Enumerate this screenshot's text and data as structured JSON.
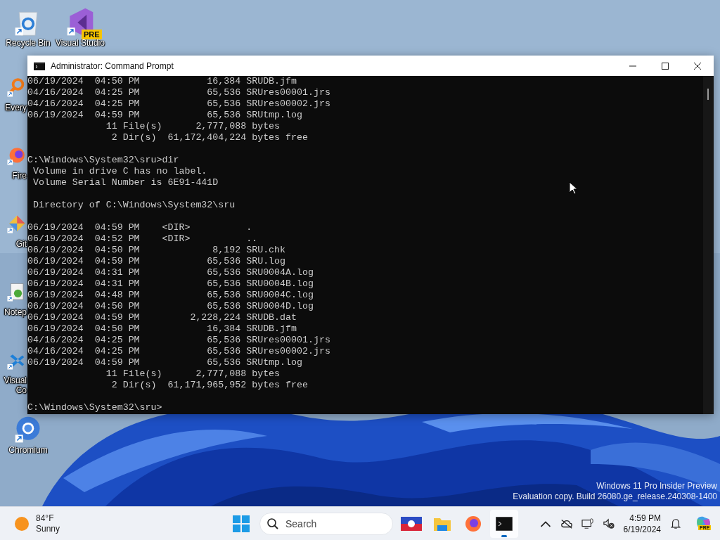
{
  "desktop_icons": [
    {
      "kind": "recycle",
      "lines": [
        "Recycle Bin"
      ]
    },
    {
      "kind": "vs",
      "lines": [
        "Visual Studio"
      ],
      "badge": "PRE"
    },
    {
      "kind": "everything",
      "lines": [
        "Every"
      ]
    },
    {
      "kind": "firefox",
      "lines": [
        "Fire"
      ]
    },
    {
      "kind": "git",
      "lines": [
        "Git"
      ]
    },
    {
      "kind": "notepad",
      "lines": [
        "Notep"
      ]
    },
    {
      "kind": "vscode",
      "lines": [
        "Visual",
        "Co"
      ]
    },
    {
      "kind": "chromium",
      "lines": [
        "Chromium"
      ]
    }
  ],
  "window": {
    "title": "Administrator: Command Prompt",
    "console_blocks": [
      [
        "06/19/2024  04:50 PM            16,384 SRUDB.jfm",
        "04/16/2024  04:25 PM            65,536 SRUres00001.jrs",
        "04/16/2024  04:25 PM            65,536 SRUres00002.jrs",
        "06/19/2024  04:59 PM            65,536 SRUtmp.log",
        "              11 File(s)      2,777,088 bytes",
        "               2 Dir(s)  61,172,404,224 bytes free"
      ],
      [
        "C:\\Windows\\System32\\sru>dir",
        " Volume in drive C has no label.",
        " Volume Serial Number is 6E91-441D"
      ],
      [
        " Directory of C:\\Windows\\System32\\sru"
      ],
      [
        "06/19/2024  04:59 PM    <DIR>          .",
        "06/19/2024  04:52 PM    <DIR>          ..",
        "06/19/2024  04:50 PM             8,192 SRU.chk",
        "06/19/2024  04:59 PM            65,536 SRU.log",
        "06/19/2024  04:31 PM            65,536 SRU0004A.log",
        "06/19/2024  04:31 PM            65,536 SRU0004B.log",
        "06/19/2024  04:48 PM            65,536 SRU0004C.log",
        "06/19/2024  04:50 PM            65,536 SRU0004D.log",
        "06/19/2024  04:59 PM         2,228,224 SRUDB.dat",
        "06/19/2024  04:50 PM            16,384 SRUDB.jfm",
        "04/16/2024  04:25 PM            65,536 SRUres00001.jrs",
        "04/16/2024  04:25 PM            65,536 SRUres00002.jrs",
        "06/19/2024  04:59 PM            65,536 SRUtmp.log",
        "              11 File(s)      2,777,088 bytes",
        "               2 Dir(s)  61,171,965,952 bytes free"
      ],
      [
        "C:\\Windows\\System32\\sru>"
      ]
    ]
  },
  "watermark": [
    "Windows 11 Pro Insider Preview",
    "Evaluation copy. Build 26080.ge_release.240308-1400"
  ],
  "taskbar": {
    "weather": {
      "temperature": "84°F",
      "condition": "Sunny"
    },
    "apps": [
      {
        "kind": "start",
        "selected": false
      },
      {
        "kind": "search",
        "placeholder": "Search"
      },
      {
        "kind": "flag",
        "selected": false
      },
      {
        "kind": "explorer",
        "selected": false
      },
      {
        "kind": "firefox",
        "selected": false
      },
      {
        "kind": "terminal",
        "selected": true
      }
    ],
    "time": "4:59 PM",
    "date": "6/19/2024",
    "copilot_badge": "PRE"
  }
}
